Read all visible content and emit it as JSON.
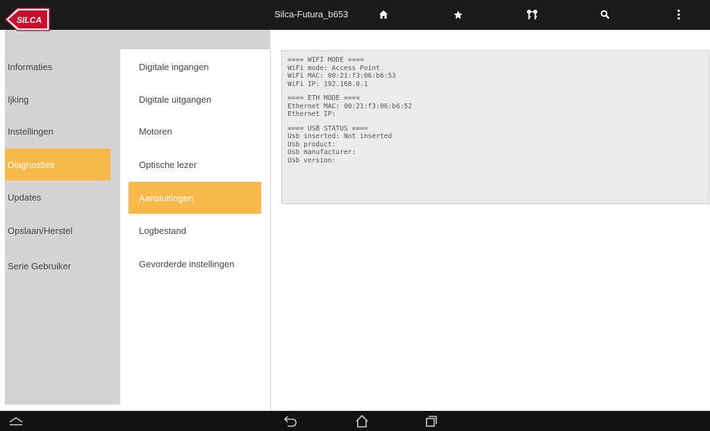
{
  "app": {
    "title": "Silca-Futura_b653",
    "logo_text": "SILCA"
  },
  "toolbar": {
    "icons": [
      "home-icon",
      "star-icon",
      "keys-icon",
      "search-icon",
      "overflow-menu-icon"
    ]
  },
  "sidebar": {
    "items": [
      {
        "label": "Informaties",
        "active": false
      },
      {
        "label": "Ijking",
        "active": false
      },
      {
        "label": "Instellingen",
        "active": false
      },
      {
        "label": "Diagnostiek",
        "active": true
      },
      {
        "label": "Updates",
        "active": false
      },
      {
        "label": "Opslaan/Herstel",
        "active": false
      },
      {
        "label": "Serie Gebruiker",
        "active": false
      }
    ]
  },
  "submenu": {
    "items": [
      {
        "label": "Digitale ingangen",
        "active": false
      },
      {
        "label": "Digitale uitgangen",
        "active": false
      },
      {
        "label": "Motoren",
        "active": false
      },
      {
        "label": "Optische lezer",
        "active": false
      },
      {
        "label": "Aansluitingen",
        "active": true
      },
      {
        "label": "Logbestand",
        "active": false
      },
      {
        "label": "Gevorderde instellingen",
        "active": false
      }
    ]
  },
  "status": {
    "wifi": [
      "==== WIFI MODE ====",
      "WiFi mode: Access Point",
      "WiFi MAC: 00:21:f3:06:b6:53",
      "WiFi IP: 192.168.0.1"
    ],
    "eth": [
      "==== ETH MODE ====",
      "Ethernet MAC: 00:21:f3:06:b6:52",
      "Ethernet IP:"
    ],
    "usb": [
      "==== USB STATUS ====",
      "Usb inserted: Not inserted",
      "Usb product:",
      "Usb manufacturer:",
      "Usb version:"
    ]
  },
  "colors": {
    "accent": "#f9b949",
    "topbar": "#1b1b1b",
    "sidebar": "#d3d3d3",
    "logo_red": "#c8102e"
  },
  "system_nav": {
    "icons": [
      "expand-icon",
      "back-icon",
      "home-nav-icon",
      "recent-apps-icon"
    ]
  }
}
